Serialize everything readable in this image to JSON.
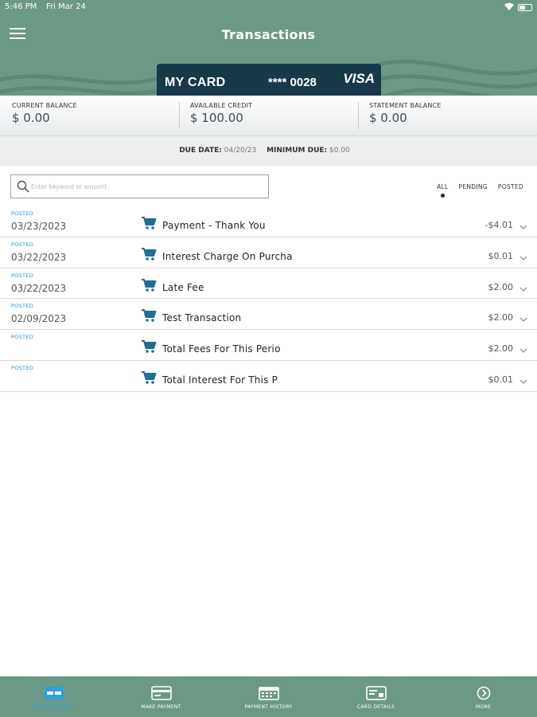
{
  "status_bar": {
    "time": "5:46 PM",
    "date": "Fri Mar 24"
  },
  "header": {
    "title": "Transactions"
  },
  "card": {
    "name": "MY CARD",
    "number": "**** 0028",
    "brand": "VISA"
  },
  "balances": [
    {
      "label": "CURRENT BALANCE",
      "value": "$ 0.00"
    },
    {
      "label": "AVAILABLE CREDIT",
      "value": "$ 100.00"
    },
    {
      "label": "STATEMENT BALANCE",
      "value": "$ 0.00"
    }
  ],
  "due": {
    "due_label": "DUE DATE:",
    "due_value": "04/20/23",
    "min_label": "MINIMUM DUE:",
    "min_value": "$0.00"
  },
  "search": {
    "placeholder": "Enter keyword or amount"
  },
  "filters": [
    "ALL",
    "PENDING",
    "POSTED"
  ],
  "transactions": [
    {
      "status": "POSTED",
      "date": "03/23/2023",
      "description": "Payment - Thank You",
      "amount": "-$4.01"
    },
    {
      "status": "POSTED",
      "date": "03/22/2023",
      "description": "Interest Charge On Purcha",
      "amount": "$0.01"
    },
    {
      "status": "POSTED",
      "date": "03/22/2023",
      "description": "Late Fee",
      "amount": "$2.00"
    },
    {
      "status": "POSTED",
      "date": "02/09/2023",
      "description": "Test Transaction",
      "amount": "$2.00"
    },
    {
      "status": "POSTED",
      "date": "",
      "description": "Total Fees For This Perio",
      "amount": "$2.00"
    },
    {
      "status": "POSTED",
      "date": "",
      "description": "Total Interest For This P",
      "amount": "$0.01"
    }
  ],
  "tabs": [
    {
      "label": "TRANSACTIONS",
      "icon": "transactions-icon"
    },
    {
      "label": "MAKE PAYMENT",
      "icon": "payment-card-icon"
    },
    {
      "label": "PAYMENT HISTORY",
      "icon": "calendar-icon"
    },
    {
      "label": "CARD DETAILS",
      "icon": "card-details-icon"
    },
    {
      "label": "MORE",
      "icon": "chevron-circle-icon"
    }
  ],
  "colors": {
    "header": "#6a9a86",
    "card": "#17394a",
    "accent": "#2f8fd0",
    "cart_icon": "#1d6f96"
  }
}
